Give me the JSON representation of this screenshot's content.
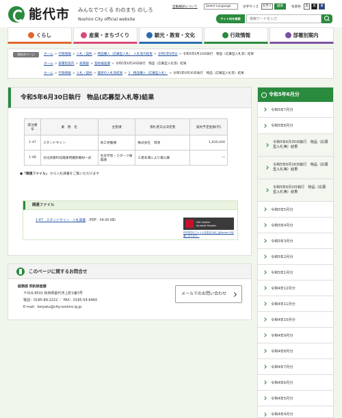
{
  "header": {
    "site_name": "能代市",
    "tagline": "みんなでつくる わのまち のしろ",
    "site_en": "Noshiro City official website",
    "auto_translate": "自動翻訳について",
    "language_select": "Select Language",
    "font_size_label": "文字サイズ",
    "font_large": "大きく",
    "font_standard": "標準",
    "bg_color_label": "背景色",
    "color_white": "白",
    "color_black": "黒",
    "color_blue": "青",
    "search_label": "サイト内を検索",
    "search_placeholder": "検索ワードを入力"
  },
  "gnav": [
    {
      "label": "くらし",
      "color": "#e0662b"
    },
    {
      "label": "産業・まちづくり",
      "color": "#d9487a"
    },
    {
      "label": "観光・教育・文化",
      "color": "#2a6bb0"
    },
    {
      "label": "行政情報",
      "color": "#2a8a3e"
    },
    {
      "label": "部署別案内",
      "color": "#7b4fa0"
    }
  ],
  "breadcrumbs": {
    "label": "現在のページ",
    "line1": [
      "ホーム",
      "行政情報",
      "入札・契約",
      "物品購入（応募型入札）　入札等の結果",
      "令和5年6月分",
      "令和5年6月30日執行　物品（応募型入札等）結果"
    ],
    "line2": [
      "ホーム",
      "部署別案内",
      "総務部",
      "契約検査課",
      "令和5年6月30日執行　物品（応募型入札等）結果"
    ],
    "line3": [
      "ホーム",
      "行政情報",
      "入札・契約",
      "最新の入札等結果",
      "3　物品購入（応募型入札）",
      "令和5年6月30日執行　物品（応募型入札等）結果"
    ]
  },
  "page_title": "令和5年6月30日執行　物品(応募型入札等)結果",
  "table": {
    "headers": [
      "発注番号",
      "業　務　名",
      "主管課",
      "落札者又は決定者",
      "契約予定金額(円)"
    ],
    "rows": [
      [
        "1-47",
        "スタンドサイン",
        "商工労働課",
        "株式会社　環清",
        "1,830,400"
      ],
      [
        "1-48",
        "文化財資料収蔵庫用撮影機材一式",
        "生涯学習・スポーツ振興課",
        "三者未満により再公募",
        "―"
      ]
    ]
  },
  "note_bold": "「関連ファイル」",
  "note_text": "から入札調書をご覧いただけます",
  "related": {
    "title": "関連ファイル",
    "link": "1-47　スタンドサイン　入札調書",
    "link_meta": "（PDF：54.00 KB）",
    "adobe_line1": "Get Adobe",
    "adobe_line2": "Acrobat Reader",
    "adobe_note": "PDF形式のファイルを見るためにはReader が必要になります。"
  },
  "inquiry": {
    "title": "このページに関するお問合せ",
    "dept": "総務部 契約検査課",
    "address": "〒016-8501 秋田県能代市上町1番3号",
    "tel_fax": "電話：0185-89-2222 ／ FAX：0185-54-6460",
    "email": "E-mail：keiyaku@city.noshiro.lg.jp",
    "mail_button": "メールでのお問い合わせ"
  },
  "sidebar": {
    "title": "令和5年6月分",
    "items": [
      {
        "label": "令和5年7月分",
        "sub": false
      },
      {
        "label": "令和5年6月分",
        "sub": false
      },
      {
        "label": "令和5年6月30日執行　物品（応募型入札等）結果",
        "sub": true
      },
      {
        "label": "令和5年6月16日執行　物品（応募型入札等）結果",
        "sub": true
      },
      {
        "label": "令和5年6月2日執行　物品（応募型入札等）結果",
        "sub": true
      },
      {
        "label": "令和5年5月分",
        "sub": false
      },
      {
        "label": "令和5年4月分",
        "sub": false
      },
      {
        "label": "令和5年3月分",
        "sub": false
      },
      {
        "label": "令和5年2月分",
        "sub": false
      },
      {
        "label": "令和5年1月分",
        "sub": false
      },
      {
        "label": "令和4年12月分",
        "sub": false
      },
      {
        "label": "令和4年11月分",
        "sub": false
      },
      {
        "label": "令和4年10月分",
        "sub": false
      },
      {
        "label": "令和4年9月分",
        "sub": false
      },
      {
        "label": "令和4年8月分",
        "sub": false
      },
      {
        "label": "令和4年7月分",
        "sub": false
      },
      {
        "label": "令和4年6月分",
        "sub": false
      },
      {
        "label": "令和4年5月分",
        "sub": false
      },
      {
        "label": "令和4年4月分",
        "sub": false
      }
    ]
  }
}
